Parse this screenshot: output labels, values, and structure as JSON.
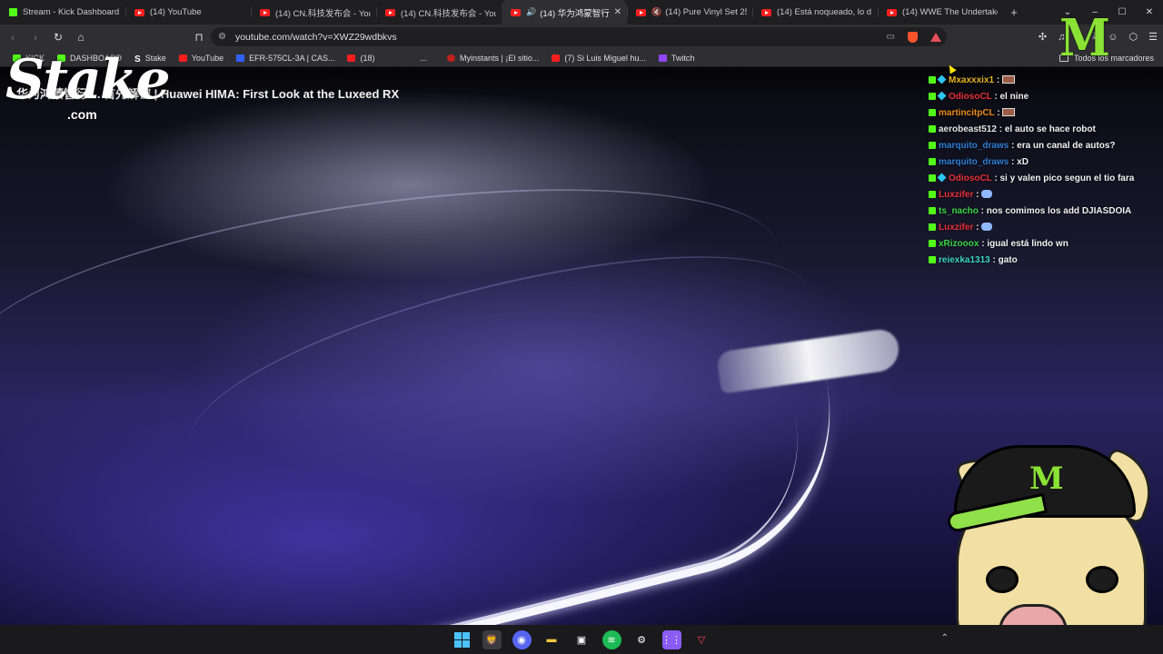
{
  "browser": {
    "tabs": [
      {
        "label": "Stream - Kick Dashboard",
        "icon": "kick-icon"
      },
      {
        "label": "(14) YouTube",
        "icon": "youtube-icon"
      },
      {
        "label": "(14) CN.科技发布会 - You",
        "icon": "youtube-icon"
      },
      {
        "label": "(14) CN.科技发布会 - You",
        "icon": "youtube-icon"
      },
      {
        "label": "(14) 华为鸿蒙智行",
        "icon": "youtube-icon",
        "active": true
      },
      {
        "label": "(14) Pure Vinyl Set 25",
        "icon": "youtube-icon"
      },
      {
        "label": "(14) Está noqueado, lo d",
        "icon": "youtube-icon"
      },
      {
        "label": "(14) WWE The Undertake",
        "icon": "youtube-icon"
      }
    ],
    "new_tab": "+",
    "window_controls": {
      "dropdown": "⌄",
      "minimize": "–",
      "maximize": "☐",
      "close": "✕"
    },
    "url": "youtube.com/watch?v=XWZ29wdbkvs",
    "bookmarks": [
      {
        "label": "KICK",
        "icon": "k"
      },
      {
        "label": "DASHBOARD",
        "icon": "k"
      },
      {
        "label": "Stake",
        "icon": "s"
      },
      {
        "label": "YouTube",
        "icon": "y"
      },
      {
        "label": "EFR-575CL-3A | CAS...",
        "icon": "b"
      },
      {
        "label": "(18)",
        "icon": "y"
      },
      {
        "label": "...",
        "icon": ""
      },
      {
        "label": "Myinstants | ¡El sitio...",
        "icon": "r"
      },
      {
        "label": "(7) Si Luis Miguel hu...",
        "icon": "y"
      },
      {
        "label": "Twitch",
        "icon": "t"
      }
    ],
    "all_bookmarks": "Todos los marcadores"
  },
  "video": {
    "title": "华为鸿蒙智行 ... 首先解密 | Huawei HIMA: First Look at the Luxeed RX"
  },
  "overlay": {
    "logo_text": "Stake",
    "logo_sub": ".com",
    "monster_logo": "M"
  },
  "chat": [
    {
      "user": "Mxaxxxix1",
      "color": "#e7b420",
      "text": "",
      "emote": true,
      "badge2": true
    },
    {
      "user": "OdiosoCL",
      "color": "#e8313b",
      "text": "el nine",
      "badge2": true
    },
    {
      "user": "martincitpCL",
      "color": "#e98a1a",
      "text": "",
      "emote": true
    },
    {
      "user": "aerobeast512",
      "color": "#e6e6e6",
      "text": "el auto se hace robot"
    },
    {
      "user": "marquito_draws",
      "color": "#2f7fd6",
      "text": "era un canal de autos?"
    },
    {
      "user": "marquito_draws",
      "color": "#2f7fd6",
      "text": "xD"
    },
    {
      "user": "OdiosoCL",
      "color": "#e8313b",
      "text": "si y valen pico segun el tio fara",
      "badge2": true
    },
    {
      "user": "Luxzifer",
      "color": "#e8313b",
      "text": "",
      "emote2": true
    },
    {
      "user": "ts_nacho",
      "color": "#3cd64a",
      "text": "nos comimos los add DJIASDOIA"
    },
    {
      "user": "Luxzifer",
      "color": "#e8313b",
      "text": "",
      "emote2": true
    },
    {
      "user": "xRizooox",
      "color": "#3cd64a",
      "text": "igual está lindo wn"
    },
    {
      "user": "reiexka1313",
      "color": "#3cd6c8",
      "text": "gato"
    }
  ]
}
